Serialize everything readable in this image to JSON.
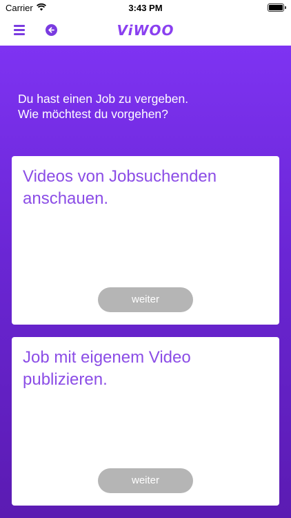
{
  "status_bar": {
    "carrier": "Carrier",
    "time": "3:43 PM"
  },
  "nav": {
    "logo": "ViWOO",
    "accent_color": "#7a3be0"
  },
  "intro_text": "Du hast einen Job zu vergeben.\nWie möchtest du vorgehen?",
  "cards": [
    {
      "title": "Videos von Jobsuchenden anschauen.",
      "button_label": "weiter"
    },
    {
      "title": "Job mit eigenem Video publizieren.",
      "button_label": "weiter"
    }
  ],
  "colors": {
    "gradient_top": "#7e33f2",
    "gradient_bottom": "#5b1bb2",
    "card_title": "#8b4de6",
    "button_bg": "#b5b5b5"
  }
}
